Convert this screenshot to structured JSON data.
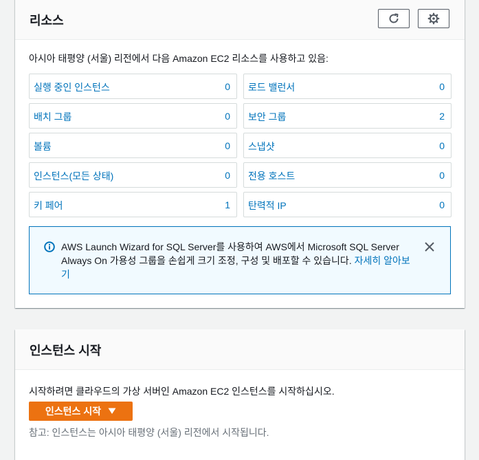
{
  "resources": {
    "title": "리소스",
    "refresh_icon": "refresh-icon",
    "settings_icon": "gear-icon",
    "intro": "아시아 태평양 (서울) 리전에서 다음 Amazon EC2 리소스를 사용하고 있음:",
    "tiles": [
      {
        "label": "실행 중인 인스턴스",
        "count": "0"
      },
      {
        "label": "로드 밸런서",
        "count": "0"
      },
      {
        "label": "배치 그룹",
        "count": "0"
      },
      {
        "label": "보안 그룹",
        "count": "2"
      },
      {
        "label": "볼륨",
        "count": "0"
      },
      {
        "label": "스냅샷",
        "count": "0"
      },
      {
        "label": "인스턴스(모든 상태)",
        "count": "0"
      },
      {
        "label": "전용 호스트",
        "count": "0"
      },
      {
        "label": "키 페어",
        "count": "1"
      },
      {
        "label": "탄력적 IP",
        "count": "0"
      }
    ],
    "alert": {
      "text": "AWS Launch Wizard for SQL Server를 사용하여 AWS에서 Microsoft SQL Server Always On 가용성 그룹을 손쉽게 크기 조정, 구성 및 배포할 수 있습니다.",
      "link": "자세히 알아보기",
      "icon": "info-icon",
      "close_icon": "close-icon"
    }
  },
  "launch": {
    "title": "인스턴스 시작",
    "description": "시작하려면 클라우드의 가상 서버인 Amazon EC2 인스턴스를 시작하십시오.",
    "button_label": "인스턴스 시작",
    "button_icon": "caret-down-icon",
    "note": "참고: 인스턴스는 아시아 태평양 (서울) 리전에서 시작됩니다."
  },
  "colors": {
    "link": "#0073bb",
    "primary_button": "#ec7211",
    "alert_border": "#0073bb",
    "alert_bg": "#f1faff"
  }
}
